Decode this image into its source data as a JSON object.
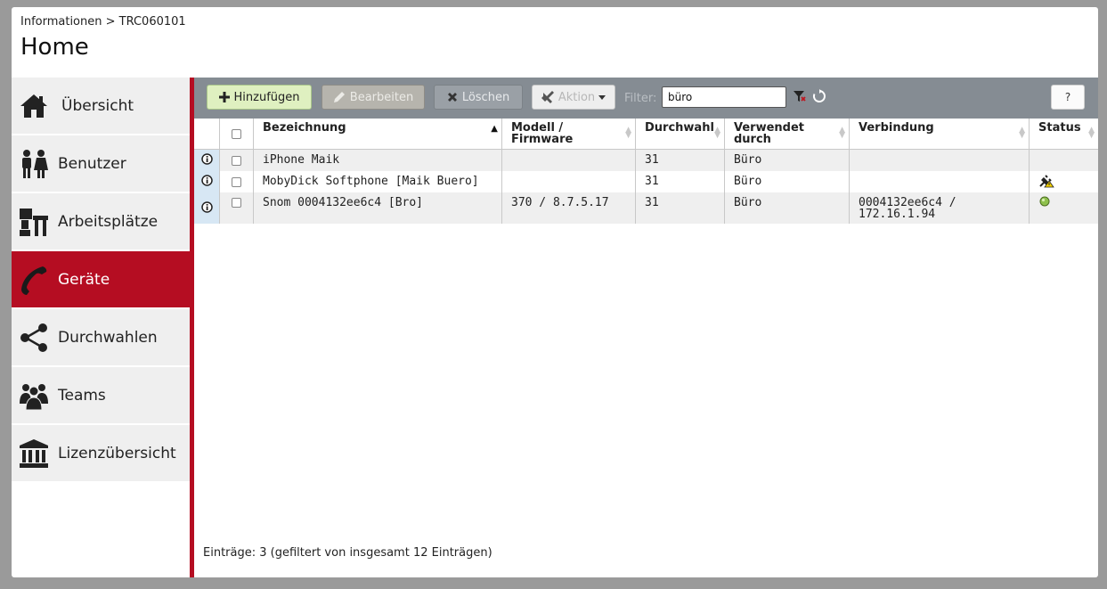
{
  "header": {
    "breadcrumb": "Informationen > TRC060101",
    "title": "Home"
  },
  "sidebar": {
    "items": [
      {
        "label": "Übersicht",
        "icon": "home-icon"
      },
      {
        "label": "Benutzer",
        "icon": "users-icon"
      },
      {
        "label": "Arbeitsplätze",
        "icon": "workplace-icon"
      },
      {
        "label": "Geräte",
        "icon": "phone-icon",
        "active": true
      },
      {
        "label": "Durchwahlen",
        "icon": "share-icon"
      },
      {
        "label": "Teams",
        "icon": "team-icon"
      },
      {
        "label": "Lizenzübersicht",
        "icon": "bank-icon"
      }
    ]
  },
  "toolbar": {
    "add_label": "Hinzufügen",
    "edit_label": "Bearbeiten",
    "delete_label": "Löschen",
    "action_label": "Aktion",
    "filter_label": "Filter:",
    "filter_value": "büro",
    "help_label": "?"
  },
  "table": {
    "columns": [
      {
        "line1": "Bezeichnung",
        "line2": ""
      },
      {
        "line1": "Modell /",
        "line2": "Firmware"
      },
      {
        "line1": "Durchwahl",
        "line2": ""
      },
      {
        "line1": "Verwendet",
        "line2": "durch"
      },
      {
        "line1": "Verbindung",
        "line2": ""
      },
      {
        "line1": "Status",
        "line2": ""
      }
    ],
    "sorted_column": "Bezeichnung",
    "sort_direction": "asc",
    "rows": [
      {
        "name": "iPhone Maik",
        "model": "",
        "ext": "31",
        "used_by": "Büro",
        "conn1": "",
        "conn2": "",
        "status": ""
      },
      {
        "name": "MobyDick Softphone [Maik Buero]",
        "model": "",
        "ext": "31",
        "used_by": "Büro",
        "conn1": "",
        "conn2": "",
        "status": "warning"
      },
      {
        "name": "Snom 0004132ee6c4 [Bro]",
        "model": "370 / 8.7.5.17",
        "ext": "31",
        "used_by": "Büro",
        "conn1": "0004132ee6c4 /",
        "conn2": "172.16.1.94",
        "status": "online"
      }
    ]
  },
  "footer": {
    "summary": "Einträge: 3 (gefiltert von insgesamt 12 Einträgen)"
  },
  "colors": {
    "accent": "#b50d22",
    "toolbar": "#858c93",
    "add_button": "#dff0c0",
    "info_column": "#d7e7f4",
    "online": "#7cbb3a"
  }
}
